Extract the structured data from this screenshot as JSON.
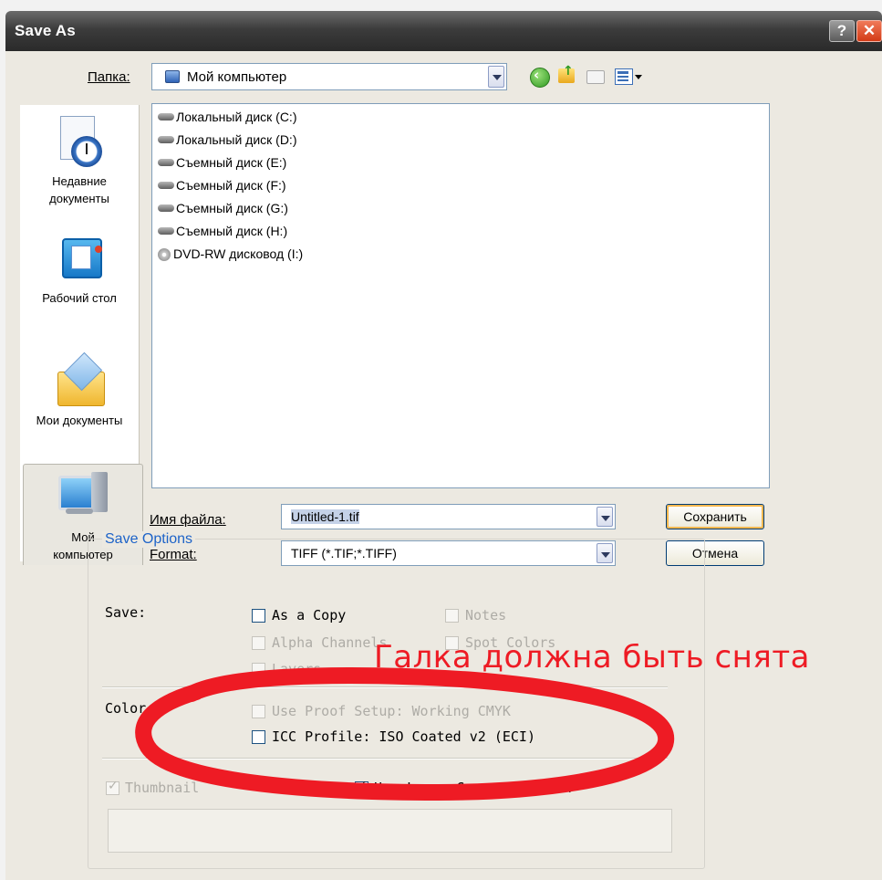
{
  "window": {
    "title": "Save As",
    "help_label": "?",
    "close_label": "✕"
  },
  "lookin": {
    "label": "Папка:",
    "value": "Мой компьютер"
  },
  "places": [
    {
      "label_line1": "Недавние",
      "label_line2": "документы",
      "icon": "recent-documents-icon"
    },
    {
      "label_line1": "Рабочий стол",
      "label_line2": "",
      "icon": "desktop-icon"
    },
    {
      "label_line1": "Мои документы",
      "label_line2": "",
      "icon": "my-documents-icon"
    },
    {
      "label_line1": "Мой",
      "label_line2": "компьютер",
      "icon": "my-computer-icon"
    }
  ],
  "files": [
    {
      "name": "Локальный диск (C:)",
      "icon": "hard-drive-icon"
    },
    {
      "name": "Локальный диск (D:)",
      "icon": "hard-drive-icon"
    },
    {
      "name": "Съемный диск (E:)",
      "icon": "removable-drive-icon"
    },
    {
      "name": "Съемный диск (F:)",
      "icon": "removable-drive-icon"
    },
    {
      "name": "Съемный диск (G:)",
      "icon": "removable-drive-icon"
    },
    {
      "name": "Съемный диск (H:)",
      "icon": "removable-drive-icon"
    },
    {
      "name": "DVD-RW дисковод (I:)",
      "icon": "dvd-drive-icon"
    }
  ],
  "filename": {
    "label": "Имя файла:",
    "value": "Untitled-1.tif"
  },
  "format": {
    "label": "Format:",
    "value": "TIFF (*.TIF;*.TIFF)"
  },
  "buttons": {
    "save": "Сохранить",
    "cancel": "Отмена"
  },
  "save_options": {
    "title": "Save Options",
    "save_label": "Save:",
    "as_copy": "As a Copy",
    "notes": "Notes",
    "alpha_channels": "Alpha Channels",
    "spot_colors": "Spot Colors",
    "layers": "Layers",
    "color_label": "Color:",
    "use_proof_setup": "Use Proof Setup:  Working CMYK",
    "icc_profile": "ICC Profile:  ISO Coated v2 (ECI)",
    "thumbnail": "Thumbnail",
    "lower_case_ext": "Use Lower Case Extension"
  },
  "annotation": {
    "text": "Галка должна быть снята",
    "color": "#ee1b24"
  }
}
